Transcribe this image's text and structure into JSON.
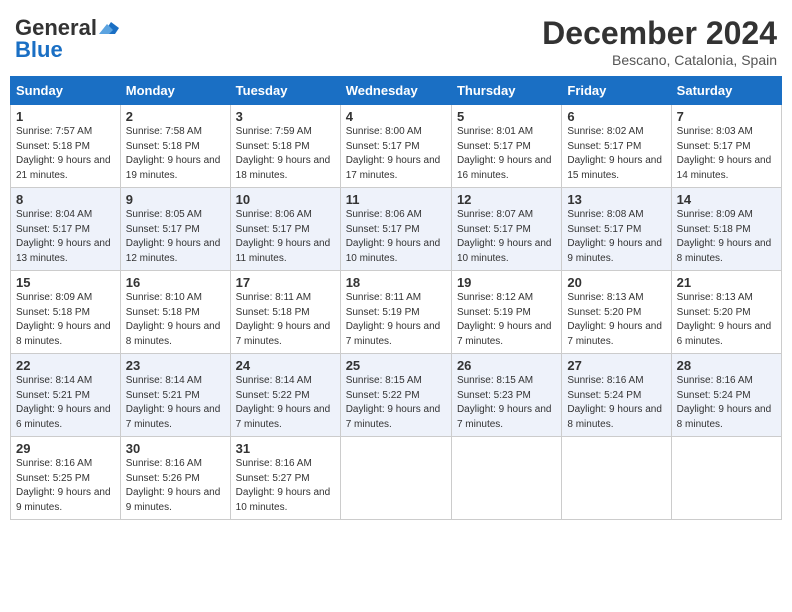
{
  "header": {
    "logo_line1": "General",
    "logo_line2": "Blue",
    "month_year": "December 2024",
    "location": "Bescano, Catalonia, Spain"
  },
  "weekdays": [
    "Sunday",
    "Monday",
    "Tuesday",
    "Wednesday",
    "Thursday",
    "Friday",
    "Saturday"
  ],
  "weeks": [
    [
      {
        "day": "1",
        "sunrise": "Sunrise: 7:57 AM",
        "sunset": "Sunset: 5:18 PM",
        "daylight": "Daylight: 9 hours and 21 minutes."
      },
      {
        "day": "2",
        "sunrise": "Sunrise: 7:58 AM",
        "sunset": "Sunset: 5:18 PM",
        "daylight": "Daylight: 9 hours and 19 minutes."
      },
      {
        "day": "3",
        "sunrise": "Sunrise: 7:59 AM",
        "sunset": "Sunset: 5:18 PM",
        "daylight": "Daylight: 9 hours and 18 minutes."
      },
      {
        "day": "4",
        "sunrise": "Sunrise: 8:00 AM",
        "sunset": "Sunset: 5:17 PM",
        "daylight": "Daylight: 9 hours and 17 minutes."
      },
      {
        "day": "5",
        "sunrise": "Sunrise: 8:01 AM",
        "sunset": "Sunset: 5:17 PM",
        "daylight": "Daylight: 9 hours and 16 minutes."
      },
      {
        "day": "6",
        "sunrise": "Sunrise: 8:02 AM",
        "sunset": "Sunset: 5:17 PM",
        "daylight": "Daylight: 9 hours and 15 minutes."
      },
      {
        "day": "7",
        "sunrise": "Sunrise: 8:03 AM",
        "sunset": "Sunset: 5:17 PM",
        "daylight": "Daylight: 9 hours and 14 minutes."
      }
    ],
    [
      {
        "day": "8",
        "sunrise": "Sunrise: 8:04 AM",
        "sunset": "Sunset: 5:17 PM",
        "daylight": "Daylight: 9 hours and 13 minutes."
      },
      {
        "day": "9",
        "sunrise": "Sunrise: 8:05 AM",
        "sunset": "Sunset: 5:17 PM",
        "daylight": "Daylight: 9 hours and 12 minutes."
      },
      {
        "day": "10",
        "sunrise": "Sunrise: 8:06 AM",
        "sunset": "Sunset: 5:17 PM",
        "daylight": "Daylight: 9 hours and 11 minutes."
      },
      {
        "day": "11",
        "sunrise": "Sunrise: 8:06 AM",
        "sunset": "Sunset: 5:17 PM",
        "daylight": "Daylight: 9 hours and 10 minutes."
      },
      {
        "day": "12",
        "sunrise": "Sunrise: 8:07 AM",
        "sunset": "Sunset: 5:17 PM",
        "daylight": "Daylight: 9 hours and 10 minutes."
      },
      {
        "day": "13",
        "sunrise": "Sunrise: 8:08 AM",
        "sunset": "Sunset: 5:17 PM",
        "daylight": "Daylight: 9 hours and 9 minutes."
      },
      {
        "day": "14",
        "sunrise": "Sunrise: 8:09 AM",
        "sunset": "Sunset: 5:18 PM",
        "daylight": "Daylight: 9 hours and 8 minutes."
      }
    ],
    [
      {
        "day": "15",
        "sunrise": "Sunrise: 8:09 AM",
        "sunset": "Sunset: 5:18 PM",
        "daylight": "Daylight: 9 hours and 8 minutes."
      },
      {
        "day": "16",
        "sunrise": "Sunrise: 8:10 AM",
        "sunset": "Sunset: 5:18 PM",
        "daylight": "Daylight: 9 hours and 8 minutes."
      },
      {
        "day": "17",
        "sunrise": "Sunrise: 8:11 AM",
        "sunset": "Sunset: 5:18 PM",
        "daylight": "Daylight: 9 hours and 7 minutes."
      },
      {
        "day": "18",
        "sunrise": "Sunrise: 8:11 AM",
        "sunset": "Sunset: 5:19 PM",
        "daylight": "Daylight: 9 hours and 7 minutes."
      },
      {
        "day": "19",
        "sunrise": "Sunrise: 8:12 AM",
        "sunset": "Sunset: 5:19 PM",
        "daylight": "Daylight: 9 hours and 7 minutes."
      },
      {
        "day": "20",
        "sunrise": "Sunrise: 8:13 AM",
        "sunset": "Sunset: 5:20 PM",
        "daylight": "Daylight: 9 hours and 7 minutes."
      },
      {
        "day": "21",
        "sunrise": "Sunrise: 8:13 AM",
        "sunset": "Sunset: 5:20 PM",
        "daylight": "Daylight: 9 hours and 6 minutes."
      }
    ],
    [
      {
        "day": "22",
        "sunrise": "Sunrise: 8:14 AM",
        "sunset": "Sunset: 5:21 PM",
        "daylight": "Daylight: 9 hours and 6 minutes."
      },
      {
        "day": "23",
        "sunrise": "Sunrise: 8:14 AM",
        "sunset": "Sunset: 5:21 PM",
        "daylight": "Daylight: 9 hours and 7 minutes."
      },
      {
        "day": "24",
        "sunrise": "Sunrise: 8:14 AM",
        "sunset": "Sunset: 5:22 PM",
        "daylight": "Daylight: 9 hours and 7 minutes."
      },
      {
        "day": "25",
        "sunrise": "Sunrise: 8:15 AM",
        "sunset": "Sunset: 5:22 PM",
        "daylight": "Daylight: 9 hours and 7 minutes."
      },
      {
        "day": "26",
        "sunrise": "Sunrise: 8:15 AM",
        "sunset": "Sunset: 5:23 PM",
        "daylight": "Daylight: 9 hours and 7 minutes."
      },
      {
        "day": "27",
        "sunrise": "Sunrise: 8:16 AM",
        "sunset": "Sunset: 5:24 PM",
        "daylight": "Daylight: 9 hours and 8 minutes."
      },
      {
        "day": "28",
        "sunrise": "Sunrise: 8:16 AM",
        "sunset": "Sunset: 5:24 PM",
        "daylight": "Daylight: 9 hours and 8 minutes."
      }
    ],
    [
      {
        "day": "29",
        "sunrise": "Sunrise: 8:16 AM",
        "sunset": "Sunset: 5:25 PM",
        "daylight": "Daylight: 9 hours and 9 minutes."
      },
      {
        "day": "30",
        "sunrise": "Sunrise: 8:16 AM",
        "sunset": "Sunset: 5:26 PM",
        "daylight": "Daylight: 9 hours and 9 minutes."
      },
      {
        "day": "31",
        "sunrise": "Sunrise: 8:16 AM",
        "sunset": "Sunset: 5:27 PM",
        "daylight": "Daylight: 9 hours and 10 minutes."
      },
      null,
      null,
      null,
      null
    ]
  ]
}
